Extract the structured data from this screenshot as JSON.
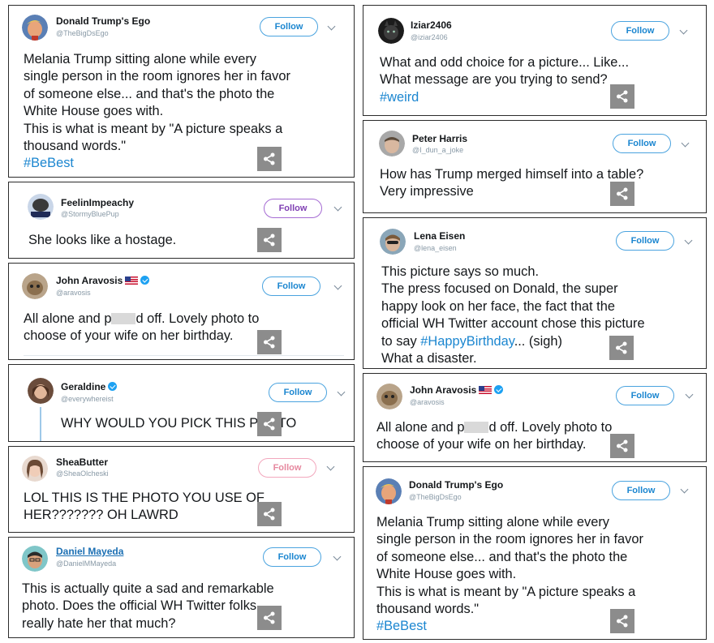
{
  "follow_label": "Follow",
  "colors": {
    "link": "#1b86d0",
    "follow_blue": "#4aa3df",
    "follow_purple": "#a56bd3",
    "follow_pink": "#f2a7bd",
    "share_bg": "#8c8c8c"
  },
  "icons": {
    "share": "share-icon",
    "menu": "chevron-down-icon",
    "verified": "verified-badge-icon",
    "flag": "us-flag-icon"
  },
  "tweets": [
    {
      "name": "Donald Trump's Ego",
      "handle": "@TheBigDsEgo",
      "text": "Melania Trump sitting alone while every\nsingle person in the room ignores her in favor\nof someone else... and that's the photo the\nWhite House goes with.\nThis is what is meant by \"A picture speaks a\nthousand words.\"",
      "hashtag": "#BeBest"
    },
    {
      "name": "FeelinImpeachy",
      "handle": "@StormyBluePup",
      "text": "She looks like a hostage."
    },
    {
      "name": "John Aravosis",
      "handle": "@aravosis",
      "text_before": "All alone and p",
      "text_after": "d off. Lovely photo to\nchoose of your wife on her birthday."
    },
    {
      "name": "Geraldine",
      "handle": "@everywhereist",
      "text": "WHY WOULD YOU PICK THIS PHOTO"
    },
    {
      "name": "SheaButter",
      "handle": "@SheaOlcheski",
      "text": "LOL THIS IS THE PHOTO YOU USE OF\nHER??????? OH LAWRD"
    },
    {
      "name": "Daniel Mayeda",
      "handle": "@DanielMMayeda",
      "text": "This is actually quite a sad and remarkable\nphoto.  Does the official WH Twitter folks\nreally hate her that much?"
    },
    {
      "name": "Iziar2406",
      "handle": "@iziar2406",
      "text": "What and odd choice for a picture... Like...\nWhat message are you trying to send?",
      "hashtag": "#weird"
    },
    {
      "name": "Peter Harris",
      "handle": "@I_dun_a_joke",
      "text": "How has Trump merged himself into a table?\nVery impressive"
    },
    {
      "name": "Lena Eisen",
      "handle": "@lena_eisen",
      "text_before": "This picture says so much.\nThe press focused on Donald, the super\nhappy look on her face, the fact that the\nofficial WH Twitter account chose this picture\nto say ",
      "hashtag": "#HappyBirthday",
      "text_after": "... (sigh)\nWhat a disaster."
    },
    {
      "name": "John Aravosis",
      "handle": "@aravosis",
      "text_before": "All alone and p",
      "text_after": "d off. Lovely photo to\nchoose of your wife on her birthday."
    },
    {
      "name": "Donald Trump's Ego",
      "handle": "@TheBigDsEgo",
      "text": "Melania Trump sitting alone while every\nsingle person in the room ignores her in favor\nof someone else... and that's the photo the\nWhite House goes with.\nThis is what is meant by \"A picture speaks a\nthousand words.\"",
      "hashtag": "#BeBest"
    }
  ]
}
